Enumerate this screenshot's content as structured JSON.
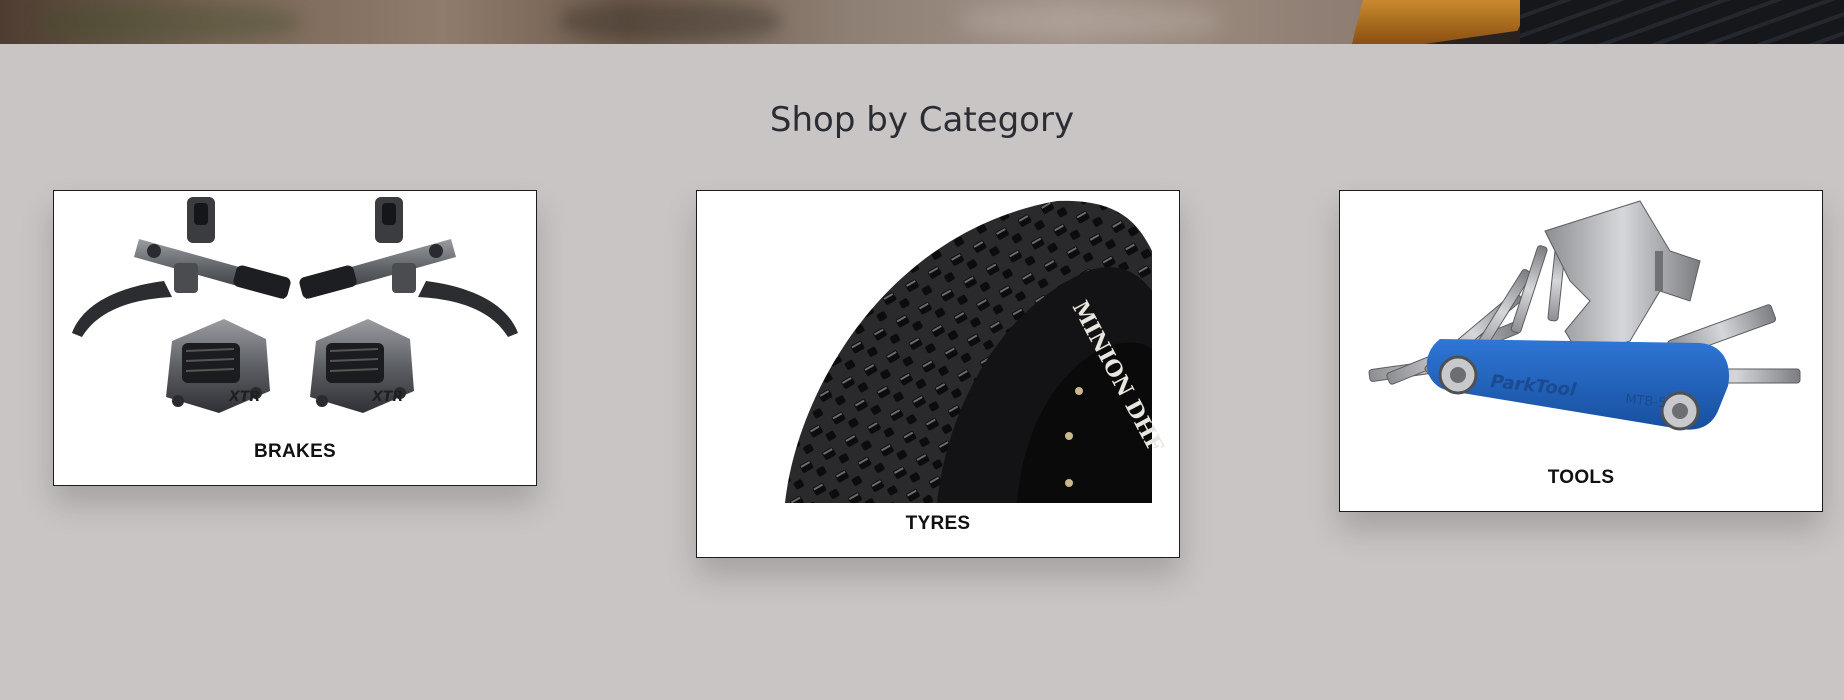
{
  "section": {
    "title": "Shop by Category"
  },
  "categories": [
    {
      "label": "BRAKES",
      "icon": "brakes-image"
    },
    {
      "label": "TYRES",
      "icon": "tyre-image"
    },
    {
      "label": "TOOLS",
      "icon": "multitool-image"
    }
  ],
  "colors": {
    "page_background": "#c9c5c4",
    "title_text": "#2c2d33",
    "card_background": "#ffffff",
    "card_border": "#1c1c1c",
    "tool_blue": "#1e5fbf"
  }
}
